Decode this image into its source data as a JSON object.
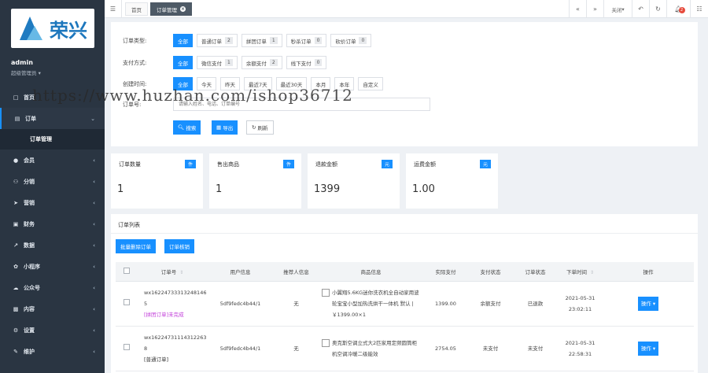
{
  "logo": {
    "text": "荣兴"
  },
  "user": {
    "name": "admin",
    "role": "超级管理员"
  },
  "nav": [
    {
      "label": "首页",
      "icon": "square-icon"
    },
    {
      "label": "订单",
      "icon": "file-icon",
      "active": true
    },
    {
      "label": "会员",
      "icon": "user-icon"
    },
    {
      "label": "分销",
      "icon": "network-icon"
    },
    {
      "label": "营销",
      "icon": "send-icon"
    },
    {
      "label": "财务",
      "icon": "money-icon"
    },
    {
      "label": "数据",
      "icon": "chart-icon"
    },
    {
      "label": "小程序",
      "icon": "applet-icon"
    },
    {
      "label": "公众号",
      "icon": "wechat-icon"
    },
    {
      "label": "内容",
      "icon": "content-icon"
    },
    {
      "label": "设置",
      "icon": "gear-icon"
    },
    {
      "label": "维护",
      "icon": "wrench-icon"
    }
  ],
  "nav_sub": {
    "label": "订单管理"
  },
  "topbar": {
    "tabs": [
      "首页",
      "订单管理"
    ],
    "close_label": "关闭",
    "notify_count": "2"
  },
  "filters": {
    "type_label": "订单类型:",
    "type_chips": [
      {
        "label": "全部"
      },
      {
        "label": "普通订单",
        "count": "2"
      },
      {
        "label": "拼团订单",
        "count": "1"
      },
      {
        "label": "秒杀订单",
        "count": "0"
      },
      {
        "label": "砍价订单",
        "count": "0"
      }
    ],
    "pay_label": "支付方式:",
    "pay_chips": [
      {
        "label": "全部"
      },
      {
        "label": "微信支付",
        "count": "1"
      },
      {
        "label": "余额支付",
        "count": "2"
      },
      {
        "label": "线下支付",
        "count": "0"
      }
    ],
    "time_label": "创建时间:",
    "time_chips": [
      "全部",
      "今天",
      "昨天",
      "最近7天",
      "最近30天",
      "本月",
      "本年",
      "自定义"
    ],
    "order_label": "订单号:",
    "order_placeholder": "请输入姓名、电话、订单编号",
    "search_btn": "搜索",
    "export_btn": "导出",
    "refresh_btn": "刷新"
  },
  "stats": [
    {
      "label": "订单数量",
      "tag": "件",
      "value": "1"
    },
    {
      "label": "售出商品",
      "tag": "件",
      "value": "1"
    },
    {
      "label": "退款金额",
      "tag": "元",
      "value": "1399"
    },
    {
      "label": "运费金额",
      "tag": "元",
      "value": "1.00"
    }
  ],
  "order_list": {
    "title": "订单列表",
    "btn_batch_delete": "批量删除订单",
    "btn_verify": "订单核销",
    "columns": [
      "订单号",
      "用户信息",
      "推荐人信息",
      "商品信息",
      "实际支付",
      "支付状态",
      "订单状态",
      "下单时间",
      "操作"
    ],
    "rows": [
      {
        "order_no_1": "wx16224733313248146",
        "order_no_2": "5",
        "type_tag": "[拼团订单]未完成",
        "user": "5df9fedc4b44/1",
        "referrer": "无",
        "goods": "小翼翔5.6KG迷你洗衣机全自动家用波轮宝宝小型加热洗烘干一体机 默认 | ￥1399.00×1",
        "paid": "1399.00",
        "pay_status": "余额支付",
        "order_status": "已退款",
        "date": "2021-05-31",
        "time": "23:02:11",
        "action": "操作"
      },
      {
        "order_no_1": "wx16224731114312263",
        "order_no_2": "8",
        "type_tag": "[普通订单]",
        "user": "5df9fedc4b44/1",
        "referrer": "无",
        "goods": "奥克斯空调立式大2匹家用定频圆筒柜机空调冷暖二级能效",
        "paid": "2754.05",
        "pay_status": "未支付",
        "order_status": "未支付",
        "date": "2021-05-31",
        "time": "22:58:31",
        "action": "操作"
      }
    ]
  },
  "watermark": "https://www.huzhan.com/ishop36712"
}
